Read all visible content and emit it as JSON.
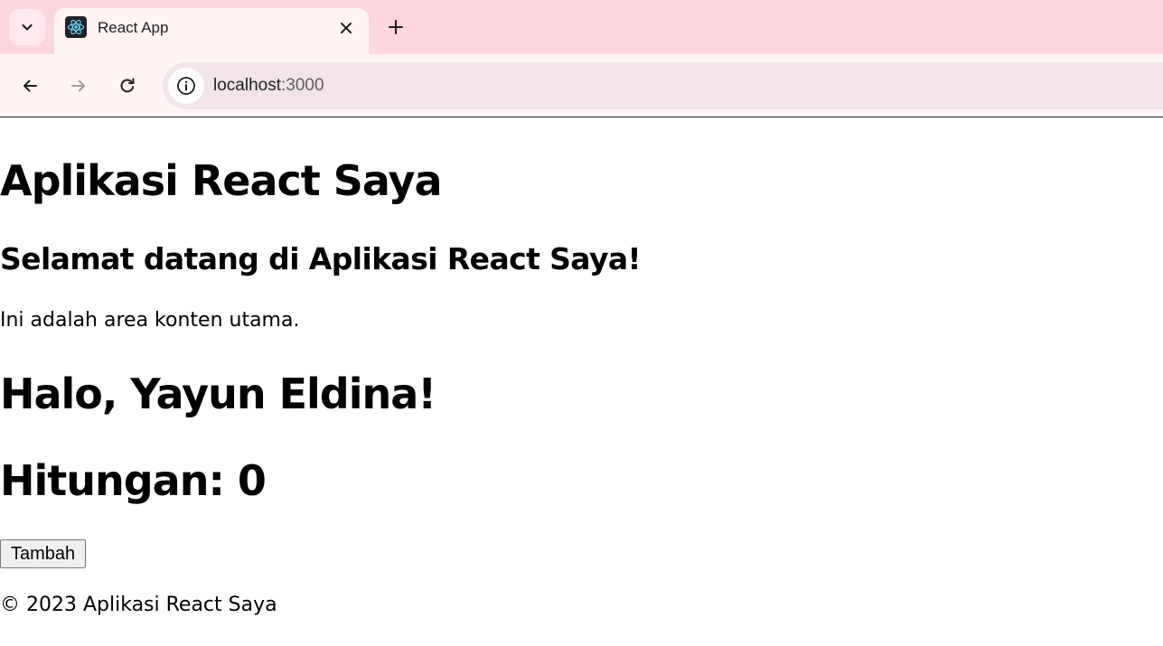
{
  "browser": {
    "tab": {
      "title": "React App",
      "favicon": "react-logo-icon"
    },
    "address_bar": {
      "host": "localhost",
      "port": ":3000"
    },
    "icons": {
      "tab_search": "chevron-down-icon",
      "close_tab": "close-icon",
      "new_tab": "plus-icon",
      "back": "arrow-left-icon",
      "forward": "arrow-right-icon",
      "reload": "reload-icon",
      "site_info": "info-icon"
    },
    "colors": {
      "tabstrip": "#fdd6df",
      "toolbar": "#fff5f5",
      "omnibox": "#f2e4e8"
    }
  },
  "page": {
    "app_title": "Aplikasi React Saya",
    "welcome_heading": "Selamat datang di Aplikasi React Saya!",
    "main_text": "Ini adalah area konten utama.",
    "greeting": "Halo, Yayun Eldina!",
    "counter": "Hitungan: 0",
    "add_button_label": "Tambah",
    "footer": "© 2023 Aplikasi React Saya"
  }
}
